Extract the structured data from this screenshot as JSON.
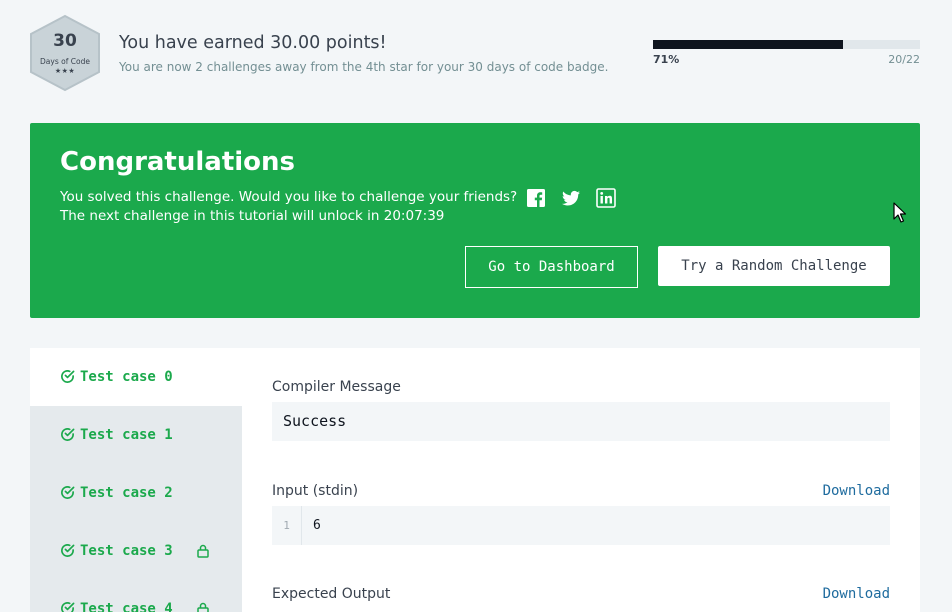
{
  "badge": {
    "number": "30",
    "label": "Days of Code",
    "stars": "★★★"
  },
  "earned": {
    "title": "You have earned 30.00 points!",
    "subtitle": "You are now 2 challenges away from the 4th star for your 30 days of code badge."
  },
  "progress": {
    "percent_label": "71%",
    "fraction": 0.71,
    "count": "20/22"
  },
  "congrats": {
    "title": "Congratulations",
    "line1": "You solved this challenge. Would you like to challenge your friends?",
    "line2": "The next challenge in this tutorial will unlock in 20:07:39",
    "social_icons": [
      "facebook-icon",
      "twitter-icon",
      "linkedin-icon"
    ],
    "dashboard_button": "Go to Dashboard",
    "random_button": "Try a Random Challenge",
    "background_color": "#1ba94c"
  },
  "test_cases": [
    {
      "label": "Test case 0",
      "locked": false,
      "active": true
    },
    {
      "label": "Test case 1",
      "locked": false,
      "active": false
    },
    {
      "label": "Test case 2",
      "locked": false,
      "active": false
    },
    {
      "label": "Test case 3",
      "locked": true,
      "active": false
    },
    {
      "label": "Test case 4",
      "locked": true,
      "active": false
    }
  ],
  "result": {
    "compiler_label": "Compiler Message",
    "compiler_message": "Success",
    "input_label": "Input (stdin)",
    "input_download": "Download",
    "input_line_number": "1",
    "input_value": "6",
    "expected_label": "Expected Output",
    "expected_download": "Download"
  },
  "colors": {
    "accent_green": "#1ba94c",
    "link_blue": "#1e6b9e",
    "dark": "#0e141e"
  }
}
